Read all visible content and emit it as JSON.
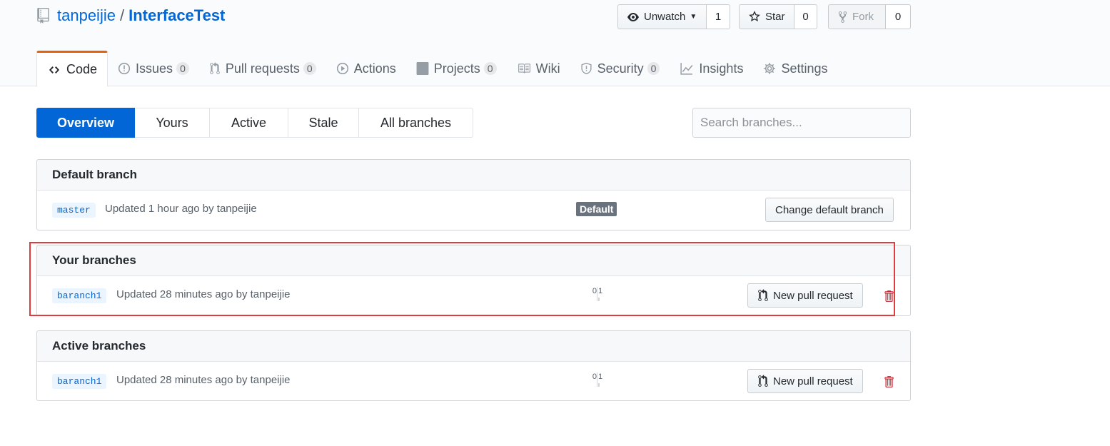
{
  "repo": {
    "owner": "tanpeijie",
    "separator": "/",
    "name": "InterfaceTest"
  },
  "actions": {
    "watch": {
      "label": "Unwatch",
      "count": "1"
    },
    "star": {
      "label": "Star",
      "count": "0"
    },
    "fork": {
      "label": "Fork",
      "count": "0"
    }
  },
  "tabs": [
    {
      "label": "Code",
      "icon": "code-icon",
      "selected": true
    },
    {
      "label": "Issues",
      "count": "0",
      "icon": "issue-icon"
    },
    {
      "label": "Pull requests",
      "count": "0",
      "icon": "pull-request-icon"
    },
    {
      "label": "Actions",
      "icon": "play-icon"
    },
    {
      "label": "Projects",
      "count": "0",
      "icon": "project-icon"
    },
    {
      "label": "Wiki",
      "icon": "book-icon"
    },
    {
      "label": "Security",
      "count": "0",
      "icon": "shield-icon"
    },
    {
      "label": "Insights",
      "icon": "graph-icon"
    },
    {
      "label": "Settings",
      "icon": "gear-icon"
    }
  ],
  "subnav": [
    {
      "label": "Overview",
      "selected": true
    },
    {
      "label": "Yours"
    },
    {
      "label": "Active"
    },
    {
      "label": "Stale"
    },
    {
      "label": "All branches"
    }
  ],
  "search": {
    "placeholder": "Search branches..."
  },
  "default_branch": {
    "title": "Default branch",
    "branch": "master",
    "meta": "Updated 1 hour ago by tanpeijie",
    "label": "Default",
    "button": "Change default branch"
  },
  "your_branches": {
    "title": "Your branches",
    "branch": "baranch1",
    "meta": "Updated 28 minutes ago by tanpeijie",
    "behind": "0",
    "ahead": "1",
    "button": "New pull request"
  },
  "active_branches": {
    "title": "Active branches",
    "branch": "baranch1",
    "meta": "Updated 28 minutes ago by tanpeijie",
    "behind": "0",
    "ahead": "1",
    "button": "New pull request"
  },
  "colors": {
    "accent": "#0366d6",
    "tab_indicator": "#e36209",
    "highlight": "#e03c3c",
    "delete": "#cb2431"
  }
}
